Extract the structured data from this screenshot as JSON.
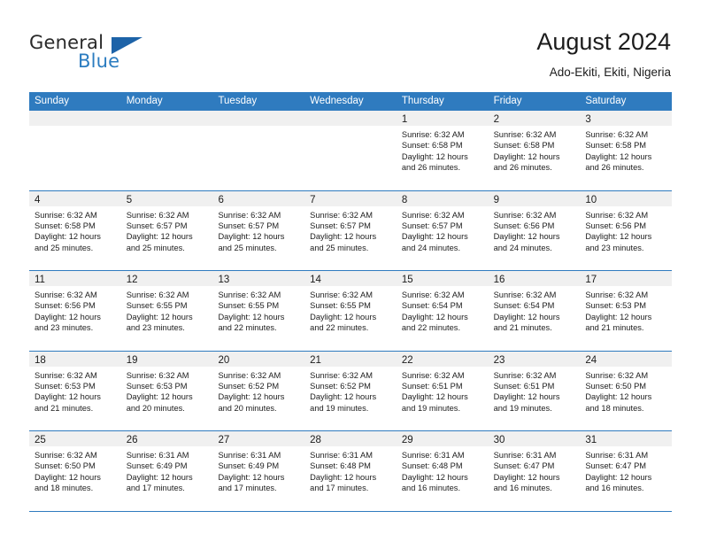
{
  "brand": {
    "name_top": "General",
    "name_bottom": "Blue",
    "accent_color": "#2b7cc0",
    "triangle_color": "#1d63a8"
  },
  "header": {
    "title": "August 2024",
    "subtitle": "Ado-Ekiti, Ekiti, Nigeria"
  },
  "theme": {
    "header_row_bg": "#2f7bbf",
    "header_row_text": "#ffffff",
    "daynum_band_bg": "#f0f0f0",
    "row_divider": "#2f7bbf"
  },
  "weekdays": [
    "Sunday",
    "Monday",
    "Tuesday",
    "Wednesday",
    "Thursday",
    "Friday",
    "Saturday"
  ],
  "weeks": [
    [
      {
        "day": "",
        "sunrise": "",
        "sunset": "",
        "daylight_1": "",
        "daylight_2": ""
      },
      {
        "day": "",
        "sunrise": "",
        "sunset": "",
        "daylight_1": "",
        "daylight_2": ""
      },
      {
        "day": "",
        "sunrise": "",
        "sunset": "",
        "daylight_1": "",
        "daylight_2": ""
      },
      {
        "day": "",
        "sunrise": "",
        "sunset": "",
        "daylight_1": "",
        "daylight_2": ""
      },
      {
        "day": "1",
        "sunrise": "Sunrise: 6:32 AM",
        "sunset": "Sunset: 6:58 PM",
        "daylight_1": "Daylight: 12 hours",
        "daylight_2": "and 26 minutes."
      },
      {
        "day": "2",
        "sunrise": "Sunrise: 6:32 AM",
        "sunset": "Sunset: 6:58 PM",
        "daylight_1": "Daylight: 12 hours",
        "daylight_2": "and 26 minutes."
      },
      {
        "day": "3",
        "sunrise": "Sunrise: 6:32 AM",
        "sunset": "Sunset: 6:58 PM",
        "daylight_1": "Daylight: 12 hours",
        "daylight_2": "and 26 minutes."
      }
    ],
    [
      {
        "day": "4",
        "sunrise": "Sunrise: 6:32 AM",
        "sunset": "Sunset: 6:58 PM",
        "daylight_1": "Daylight: 12 hours",
        "daylight_2": "and 25 minutes."
      },
      {
        "day": "5",
        "sunrise": "Sunrise: 6:32 AM",
        "sunset": "Sunset: 6:57 PM",
        "daylight_1": "Daylight: 12 hours",
        "daylight_2": "and 25 minutes."
      },
      {
        "day": "6",
        "sunrise": "Sunrise: 6:32 AM",
        "sunset": "Sunset: 6:57 PM",
        "daylight_1": "Daylight: 12 hours",
        "daylight_2": "and 25 minutes."
      },
      {
        "day": "7",
        "sunrise": "Sunrise: 6:32 AM",
        "sunset": "Sunset: 6:57 PM",
        "daylight_1": "Daylight: 12 hours",
        "daylight_2": "and 25 minutes."
      },
      {
        "day": "8",
        "sunrise": "Sunrise: 6:32 AM",
        "sunset": "Sunset: 6:57 PM",
        "daylight_1": "Daylight: 12 hours",
        "daylight_2": "and 24 minutes."
      },
      {
        "day": "9",
        "sunrise": "Sunrise: 6:32 AM",
        "sunset": "Sunset: 6:56 PM",
        "daylight_1": "Daylight: 12 hours",
        "daylight_2": "and 24 minutes."
      },
      {
        "day": "10",
        "sunrise": "Sunrise: 6:32 AM",
        "sunset": "Sunset: 6:56 PM",
        "daylight_1": "Daylight: 12 hours",
        "daylight_2": "and 23 minutes."
      }
    ],
    [
      {
        "day": "11",
        "sunrise": "Sunrise: 6:32 AM",
        "sunset": "Sunset: 6:56 PM",
        "daylight_1": "Daylight: 12 hours",
        "daylight_2": "and 23 minutes."
      },
      {
        "day": "12",
        "sunrise": "Sunrise: 6:32 AM",
        "sunset": "Sunset: 6:55 PM",
        "daylight_1": "Daylight: 12 hours",
        "daylight_2": "and 23 minutes."
      },
      {
        "day": "13",
        "sunrise": "Sunrise: 6:32 AM",
        "sunset": "Sunset: 6:55 PM",
        "daylight_1": "Daylight: 12 hours",
        "daylight_2": "and 22 minutes."
      },
      {
        "day": "14",
        "sunrise": "Sunrise: 6:32 AM",
        "sunset": "Sunset: 6:55 PM",
        "daylight_1": "Daylight: 12 hours",
        "daylight_2": "and 22 minutes."
      },
      {
        "day": "15",
        "sunrise": "Sunrise: 6:32 AM",
        "sunset": "Sunset: 6:54 PM",
        "daylight_1": "Daylight: 12 hours",
        "daylight_2": "and 22 minutes."
      },
      {
        "day": "16",
        "sunrise": "Sunrise: 6:32 AM",
        "sunset": "Sunset: 6:54 PM",
        "daylight_1": "Daylight: 12 hours",
        "daylight_2": "and 21 minutes."
      },
      {
        "day": "17",
        "sunrise": "Sunrise: 6:32 AM",
        "sunset": "Sunset: 6:53 PM",
        "daylight_1": "Daylight: 12 hours",
        "daylight_2": "and 21 minutes."
      }
    ],
    [
      {
        "day": "18",
        "sunrise": "Sunrise: 6:32 AM",
        "sunset": "Sunset: 6:53 PM",
        "daylight_1": "Daylight: 12 hours",
        "daylight_2": "and 21 minutes."
      },
      {
        "day": "19",
        "sunrise": "Sunrise: 6:32 AM",
        "sunset": "Sunset: 6:53 PM",
        "daylight_1": "Daylight: 12 hours",
        "daylight_2": "and 20 minutes."
      },
      {
        "day": "20",
        "sunrise": "Sunrise: 6:32 AM",
        "sunset": "Sunset: 6:52 PM",
        "daylight_1": "Daylight: 12 hours",
        "daylight_2": "and 20 minutes."
      },
      {
        "day": "21",
        "sunrise": "Sunrise: 6:32 AM",
        "sunset": "Sunset: 6:52 PM",
        "daylight_1": "Daylight: 12 hours",
        "daylight_2": "and 19 minutes."
      },
      {
        "day": "22",
        "sunrise": "Sunrise: 6:32 AM",
        "sunset": "Sunset: 6:51 PM",
        "daylight_1": "Daylight: 12 hours",
        "daylight_2": "and 19 minutes."
      },
      {
        "day": "23",
        "sunrise": "Sunrise: 6:32 AM",
        "sunset": "Sunset: 6:51 PM",
        "daylight_1": "Daylight: 12 hours",
        "daylight_2": "and 19 minutes."
      },
      {
        "day": "24",
        "sunrise": "Sunrise: 6:32 AM",
        "sunset": "Sunset: 6:50 PM",
        "daylight_1": "Daylight: 12 hours",
        "daylight_2": "and 18 minutes."
      }
    ],
    [
      {
        "day": "25",
        "sunrise": "Sunrise: 6:32 AM",
        "sunset": "Sunset: 6:50 PM",
        "daylight_1": "Daylight: 12 hours",
        "daylight_2": "and 18 minutes."
      },
      {
        "day": "26",
        "sunrise": "Sunrise: 6:31 AM",
        "sunset": "Sunset: 6:49 PM",
        "daylight_1": "Daylight: 12 hours",
        "daylight_2": "and 17 minutes."
      },
      {
        "day": "27",
        "sunrise": "Sunrise: 6:31 AM",
        "sunset": "Sunset: 6:49 PM",
        "daylight_1": "Daylight: 12 hours",
        "daylight_2": "and 17 minutes."
      },
      {
        "day": "28",
        "sunrise": "Sunrise: 6:31 AM",
        "sunset": "Sunset: 6:48 PM",
        "daylight_1": "Daylight: 12 hours",
        "daylight_2": "and 17 minutes."
      },
      {
        "day": "29",
        "sunrise": "Sunrise: 6:31 AM",
        "sunset": "Sunset: 6:48 PM",
        "daylight_1": "Daylight: 12 hours",
        "daylight_2": "and 16 minutes."
      },
      {
        "day": "30",
        "sunrise": "Sunrise: 6:31 AM",
        "sunset": "Sunset: 6:47 PM",
        "daylight_1": "Daylight: 12 hours",
        "daylight_2": "and 16 minutes."
      },
      {
        "day": "31",
        "sunrise": "Sunrise: 6:31 AM",
        "sunset": "Sunset: 6:47 PM",
        "daylight_1": "Daylight: 12 hours",
        "daylight_2": "and 16 minutes."
      }
    ]
  ]
}
